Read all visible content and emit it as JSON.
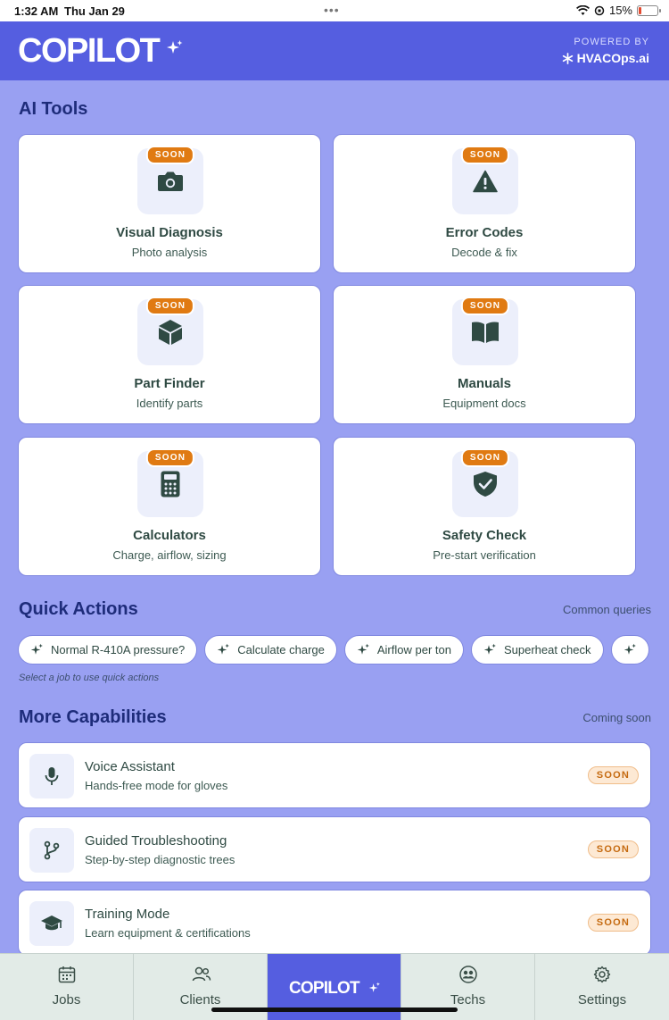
{
  "status_bar": {
    "time": "1:32 AM",
    "date": "Thu Jan 29",
    "battery": "15%",
    "battery_level": 0.15
  },
  "header": {
    "brand": "COPILOT",
    "powered_label": "POWERED BY",
    "powered_brand": "HVACOps.ai"
  },
  "ai_tools": {
    "title": "AI Tools",
    "items": [
      {
        "title": "Visual Diagnosis",
        "subtitle": "Photo analysis",
        "badge": "SOON",
        "icon": "camera-icon"
      },
      {
        "title": "Error Codes",
        "subtitle": "Decode & fix",
        "badge": "SOON",
        "icon": "warning-icon"
      },
      {
        "title": "Part Finder",
        "subtitle": "Identify parts",
        "badge": "SOON",
        "icon": "cube-icon"
      },
      {
        "title": "Manuals",
        "subtitle": "Equipment docs",
        "badge": "SOON",
        "icon": "book-icon"
      },
      {
        "title": "Calculators",
        "subtitle": "Charge, airflow, sizing",
        "badge": "SOON",
        "icon": "calculator-icon"
      },
      {
        "title": "Safety Check",
        "subtitle": "Pre-start verification",
        "badge": "SOON",
        "icon": "shield-check-icon"
      }
    ]
  },
  "quick_actions": {
    "title": "Quick Actions",
    "hint": "Common queries",
    "chips": [
      "Normal R-410A pressure?",
      "Calculate charge",
      "Airflow per ton",
      "Superheat check"
    ],
    "note": "Select a job to use quick actions"
  },
  "more_capabilities": {
    "title": "More Capabilities",
    "hint": "Coming soon",
    "items": [
      {
        "title": "Voice Assistant",
        "subtitle": "Hands-free mode for gloves",
        "badge": "SOON",
        "icon": "microphone-icon"
      },
      {
        "title": "Guided Troubleshooting",
        "subtitle": "Step-by-step diagnostic trees",
        "badge": "SOON",
        "icon": "branch-icon"
      },
      {
        "title": "Training Mode",
        "subtitle": "Learn equipment & certifications",
        "badge": "SOON",
        "icon": "graduation-cap-icon"
      }
    ]
  },
  "bottom_nav": {
    "items": [
      {
        "label": "Jobs",
        "icon": "calendar-icon"
      },
      {
        "label": "Clients",
        "icon": "users-icon"
      },
      {
        "label": "COPILOT",
        "icon": "sparkle-icon",
        "active": true
      },
      {
        "label": "Techs",
        "icon": "team-icon"
      },
      {
        "label": "Settings",
        "icon": "gear-icon"
      }
    ]
  },
  "colors": {
    "background": "#99a0f2",
    "header": "#555ee0",
    "badge": "#e07a12",
    "icon": "#2f4a43",
    "title": "#1e2c7a"
  }
}
